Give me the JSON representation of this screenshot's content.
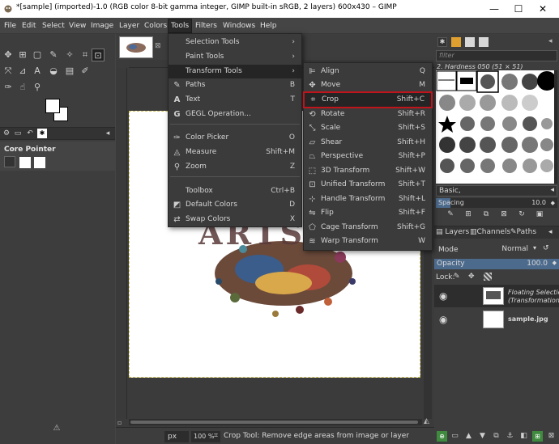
{
  "window": {
    "title": "*[sample] (imported)-1.0 (RGB color 8-bit gamma integer, GIMP built-in sRGB, 2 layers) 600x430 – GIMP",
    "minimize": "—",
    "maximize": "☐",
    "close": "✕"
  },
  "menubar": {
    "items": [
      "File",
      "Edit",
      "Select",
      "View",
      "Image",
      "Layer",
      "Colors",
      "Tools",
      "Filters",
      "Windows",
      "Help"
    ]
  },
  "tools_menu": {
    "items": [
      {
        "label": "Selection Tools",
        "shortcut": "",
        "submenu": true
      },
      {
        "label": "Paint Tools",
        "shortcut": "",
        "submenu": true
      },
      {
        "label": "Transform Tools",
        "shortcut": "",
        "submenu": true
      },
      {
        "label": "Paths",
        "shortcut": "B"
      },
      {
        "label": "Text",
        "shortcut": "T"
      },
      {
        "label": "GEGL Operation...",
        "shortcut": ""
      },
      {
        "label": "Color Picker",
        "shortcut": "O"
      },
      {
        "label": "Measure",
        "shortcut": "Shift+M"
      },
      {
        "label": "Zoom",
        "shortcut": "Z"
      },
      {
        "label": "Toolbox",
        "shortcut": "Ctrl+B"
      },
      {
        "label": "Default Colors",
        "shortcut": "D"
      },
      {
        "label": "Swap Colors",
        "shortcut": "X"
      }
    ]
  },
  "transform_menu": {
    "items": [
      {
        "label": "Align",
        "shortcut": "Q"
      },
      {
        "label": "Move",
        "shortcut": "M"
      },
      {
        "label": "Crop",
        "shortcut": "Shift+C"
      },
      {
        "label": "Rotate",
        "shortcut": "Shift+R"
      },
      {
        "label": "Scale",
        "shortcut": "Shift+S"
      },
      {
        "label": "Shear",
        "shortcut": "Shift+H"
      },
      {
        "label": "Perspective",
        "shortcut": "Shift+P"
      },
      {
        "label": "3D Transform",
        "shortcut": "Shift+W"
      },
      {
        "label": "Unified Transform",
        "shortcut": "Shift+T"
      },
      {
        "label": "Handle Transform",
        "shortcut": "Shift+L"
      },
      {
        "label": "Flip",
        "shortcut": "Shift+F"
      },
      {
        "label": "Cage Transform",
        "shortcut": "Shift+G"
      },
      {
        "label": "Warp Transform",
        "shortcut": "W"
      }
    ]
  },
  "left_dock": {
    "tool_options_title": "Core Pointer"
  },
  "right_dock": {
    "filter_placeholder": "filter",
    "brush_name": "2. Hardness 050 (51 × 51)",
    "preset_value": "Basic,",
    "spacing_label": "Spacing",
    "spacing_value": "10.0",
    "tabs": {
      "layers": "Layers",
      "channels": "Channels",
      "paths": "Paths"
    },
    "mode_label": "Mode",
    "mode_value": "Normal",
    "opacity_label": "Opacity",
    "opacity_value": "100.0",
    "lock_label": "Lock:",
    "layers": [
      {
        "name": "Floating Selection",
        "sub": "(Transformation)"
      },
      {
        "name": "sample.jpg",
        "sub": ""
      }
    ]
  },
  "statusbar": {
    "unit": "px",
    "zoom": "100 %",
    "message": "Crop Tool: Remove edge areas from image or layer"
  },
  "canvas": {
    "art_text": "ARTS"
  },
  "colors": {
    "highlight_border": "#c0141c"
  }
}
